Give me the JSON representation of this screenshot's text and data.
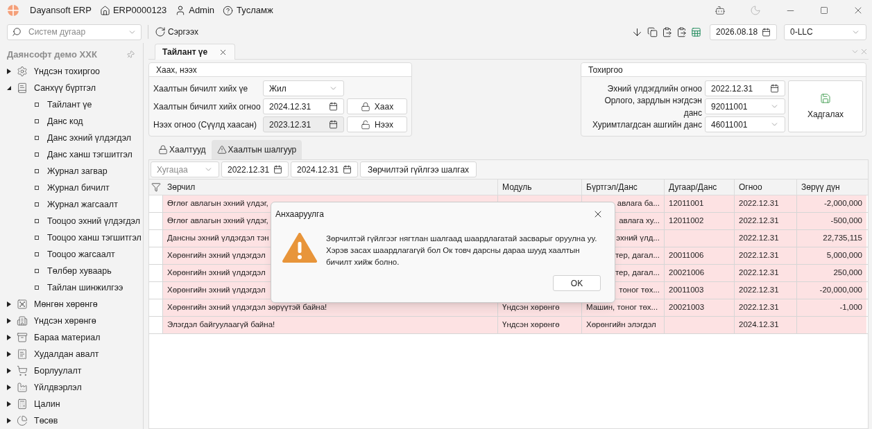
{
  "titlebar": {
    "app": "Dayansoft ERP",
    "code": "ERP0000123",
    "user": "Admin",
    "help": "Тусламж"
  },
  "toolbar": {
    "search_placeholder": "Систем дугаар",
    "refresh": "Сэргээх",
    "date": "2026.08.18",
    "company": "0-LLC"
  },
  "sidebar": {
    "title": "Даянсофт демо ХХК",
    "items": [
      {
        "kind": "settings",
        "label": "Үндсэн тохиргоо",
        "expanded": false
      },
      {
        "kind": "book",
        "label": "Санхүү бүртгэл",
        "expanded": true,
        "children": [
          {
            "label": "Тайлант үе"
          },
          {
            "label": "Данс код"
          },
          {
            "label": "Данс эхний үлдэгдэл"
          },
          {
            "label": "Данс ханш тэгшитгэл"
          },
          {
            "label": "Журнал загвар"
          },
          {
            "label": "Журнал бичилт"
          },
          {
            "label": "Журнал жагсаалт"
          },
          {
            "label": "Тооцоо эхний үлдэгдэл"
          },
          {
            "label": "Тооцоо ханш тэгшитгэл"
          },
          {
            "label": "Тооцоо жагсаалт"
          },
          {
            "label": "Төлбөр хуваарь"
          },
          {
            "label": "Тайлан шинжилгээ"
          }
        ]
      },
      {
        "kind": "vault",
        "label": "Мөнгөн хөрөнгө",
        "expanded": false
      },
      {
        "kind": "building",
        "label": "Үндсэн хөрөнгө",
        "expanded": false
      },
      {
        "kind": "archive",
        "label": "Бараа материал",
        "expanded": false
      },
      {
        "kind": "purchase",
        "label": "Худалдан авалт",
        "expanded": false
      },
      {
        "kind": "cart",
        "label": "Борлуулалт",
        "expanded": false
      },
      {
        "kind": "factory",
        "label": "Үйлдвэрлэл",
        "expanded": false
      },
      {
        "kind": "calculator",
        "label": "Цалин",
        "expanded": false
      },
      {
        "kind": "pie",
        "label": "Төсөв",
        "expanded": false
      }
    ]
  },
  "doc_tab": {
    "label": "Тайлант үе"
  },
  "close_open": {
    "title": "Хаах, нээх",
    "rows": [
      {
        "kind": "select",
        "label": "Хаалтын бичилт хийх үе",
        "value": "Жил"
      },
      {
        "kind": "date",
        "label": "Хаалтын бичилт хийх огноо",
        "value": "2024.12.31",
        "button": "Хаах",
        "disabled": false
      },
      {
        "kind": "date",
        "label": "Нээх огноо (Сүүлд хаасан)",
        "value": "2023.12.31",
        "button": "Нээх",
        "disabled": true
      }
    ]
  },
  "settings": {
    "title": "Тохиргоо",
    "rows": [
      {
        "kind": "date",
        "label": "Эхний үлдэгдлийн огноо",
        "value": "2022.12.31"
      },
      {
        "kind": "select",
        "label": "Орлого, зардлын нэгдсэн данс",
        "value": "92011001"
      },
      {
        "kind": "select",
        "label": "Хуримтлагдсан ашгийн данс",
        "value": "46011001"
      }
    ],
    "save": "Хадгалах"
  },
  "tabs": [
    {
      "label": "Хаалтууд",
      "kind": "lock",
      "selected": false
    },
    {
      "label": "Хаалтын шалгуур",
      "kind": "warning",
      "selected": true
    }
  ],
  "filter": {
    "period_placeholder": "Хугацаа",
    "from": "2022.12.31",
    "to": "2024.12.31",
    "check": "Зөрчилтэй гүйлгээ шалгах"
  },
  "table": {
    "columns": [
      "Зөрчил",
      "Модуль",
      "Бүртгэл/Данс",
      "Дугаар/Данс",
      "Огноо",
      "Зөрүү дүн"
    ],
    "rows": [
      {
        "error": true,
        "partly_covered": true,
        "cells": [
          "Өглөг авлагын эхний үлдэг,",
          null,
          "авлага ба...",
          "12011001",
          "2022.12.31",
          "-2,000,000"
        ]
      },
      {
        "error": true,
        "partly_covered": true,
        "cells": [
          "Өглөг авлагын эхний үлдэг,",
          null,
          "авлага ху...",
          "12011002",
          "2022.12.31",
          "-500,000"
        ]
      },
      {
        "error": true,
        "partly_covered": true,
        "cells": [
          "Дансны эхний үлдэгдэл тэн",
          null,
          "эхний үлд...",
          null,
          "2022.12.31",
          "22,735,115"
        ]
      },
      {
        "error": true,
        "partly_covered": true,
        "cells": [
          "Хөрөнгийн эхний үлдэгдэл",
          null,
          "тер, дагал...",
          "20011006",
          "2022.12.31",
          "5,000,000"
        ]
      },
      {
        "error": true,
        "partly_covered": true,
        "cells": [
          "Хөрөнгийн эхний үлдэгдэл",
          null,
          "тер, дагал...",
          "20021006",
          "2022.12.31",
          "250,000"
        ]
      },
      {
        "error": true,
        "partly_covered": true,
        "cells": [
          "Хөрөнгийн эхний үлдэгдэл",
          null,
          "тоног төх...",
          "20011003",
          "2022.12.31",
          "-20,000,000"
        ]
      },
      {
        "error": true,
        "partly_covered": false,
        "cells": [
          "Хөрөнгийн эхний үлдэгдэл зөрүүтэй байна!",
          "Үндсэн хөрөнгө",
          "Машин, тоног төх...",
          "20021003",
          "2022.12.31",
          "-1,000"
        ]
      },
      {
        "error": true,
        "partly_covered": false,
        "cells": [
          "Элэгдэл байгуулаагүй байна!",
          "Үндсэн хөрөнгө",
          "Хөрөнгийн элэгдэл",
          null,
          "2024.12.31",
          null
        ]
      }
    ]
  },
  "dialog": {
    "title": "Анхааруулга",
    "message": "Зөрчилтэй гүйлгээг нягтлан шалгаад шаардлагатай засварыг оруулна уу. Хэрэв засах шаардлагагүй бол Ок товч дарсны дараа шууд хаалтын бичилт хийж болно.",
    "ok": "OK"
  }
}
